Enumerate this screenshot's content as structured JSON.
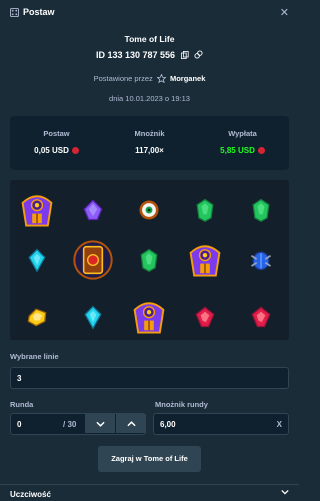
{
  "header": {
    "title": "Postaw",
    "dice_icon": "dice-icon",
    "close_icon": "close-icon"
  },
  "game": {
    "name": "Tome of Life"
  },
  "bet": {
    "id": "ID 133 130 787 556"
  },
  "placed_by": {
    "prefix": "Postawione przez",
    "user": "Morganek"
  },
  "date": "dnia 10.01.2023 o 19:13",
  "stats": {
    "bet_label": "Postaw",
    "bet_value": "0,05 USD",
    "multiplier_label": "Mnożnik",
    "multiplier_value": "117,00×",
    "payout_label": "Wypłata",
    "payout_value": "5,85 USD",
    "payout_color": "#1fff20",
    "currency_icon": "red-currency-icon"
  },
  "reels": {
    "rows": [
      [
        "pharaoh",
        "purple-gem",
        "green-eye",
        "green-gem",
        "green-gem"
      ],
      [
        "cyan-gem",
        "book-of-life",
        "green-gem",
        "pharaoh",
        "blue-scarab"
      ],
      [
        "yellow-gem",
        "cyan-gem",
        "pharaoh",
        "red-gem",
        "red-gem"
      ]
    ]
  },
  "lines": {
    "label": "Wybrane linie",
    "value": "3"
  },
  "round": {
    "label": "Runda",
    "value": "0",
    "suffix": "/ 30"
  },
  "round_multiplier": {
    "label": "Mnożnik rundy",
    "value": "6,00",
    "suffix": "X"
  },
  "play_button": {
    "label": "Zagraj w Tome of Life"
  },
  "footer": {
    "label": "Uczciwość"
  },
  "colors": {
    "background": "#1a2c38",
    "panel": "#0f212e",
    "control": "#2f4553",
    "muted_text": "#b1bad3"
  }
}
